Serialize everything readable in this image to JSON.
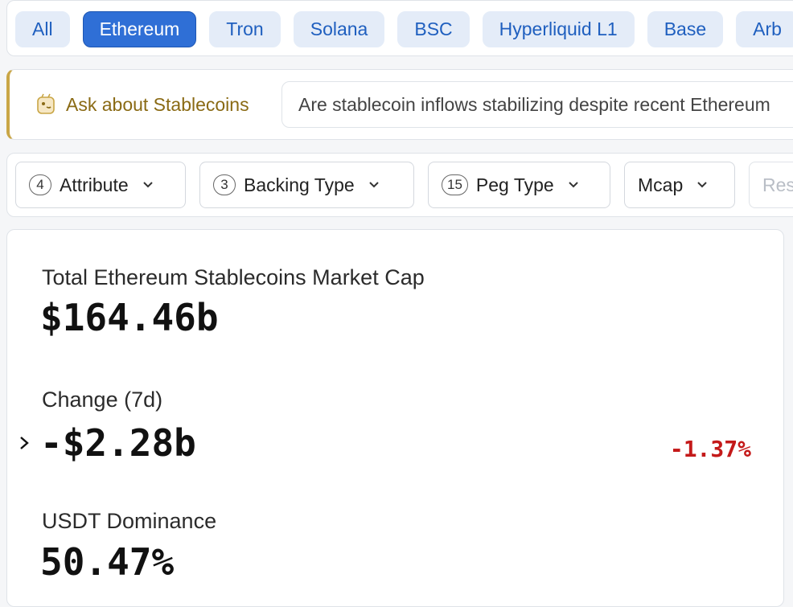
{
  "chain_tabs": [
    {
      "label": "All",
      "active": false
    },
    {
      "label": "Ethereum",
      "active": true
    },
    {
      "label": "Tron",
      "active": false
    },
    {
      "label": "Solana",
      "active": false
    },
    {
      "label": "BSC",
      "active": false
    },
    {
      "label": "Hyperliquid L1",
      "active": false
    },
    {
      "label": "Base",
      "active": false
    },
    {
      "label": "Arb",
      "active": false
    }
  ],
  "ask": {
    "label": "Ask about Stablecoins",
    "placeholder": "Are stablecoin inflows stabilizing despite recent Ethereum"
  },
  "filters": [
    {
      "count": "4",
      "label": "Attribute"
    },
    {
      "count": "3",
      "label": "Backing Type"
    },
    {
      "count": "15",
      "label": "Peg Type"
    },
    {
      "count": "",
      "label": "Mcap"
    }
  ],
  "reset_label": "Res",
  "stats": {
    "market_cap_label": "Total Ethereum Stablecoins Market Cap",
    "market_cap_value": "$164.46b",
    "change_label": "Change (7d)",
    "change_value": "-$2.28b",
    "change_pct": "-1.37%",
    "dominance_label": "USDT Dominance",
    "dominance_value": "50.47%"
  },
  "colors": {
    "accent": "#2f6fd6",
    "ask_accent": "#c9a646",
    "negative": "#c41a1a"
  }
}
